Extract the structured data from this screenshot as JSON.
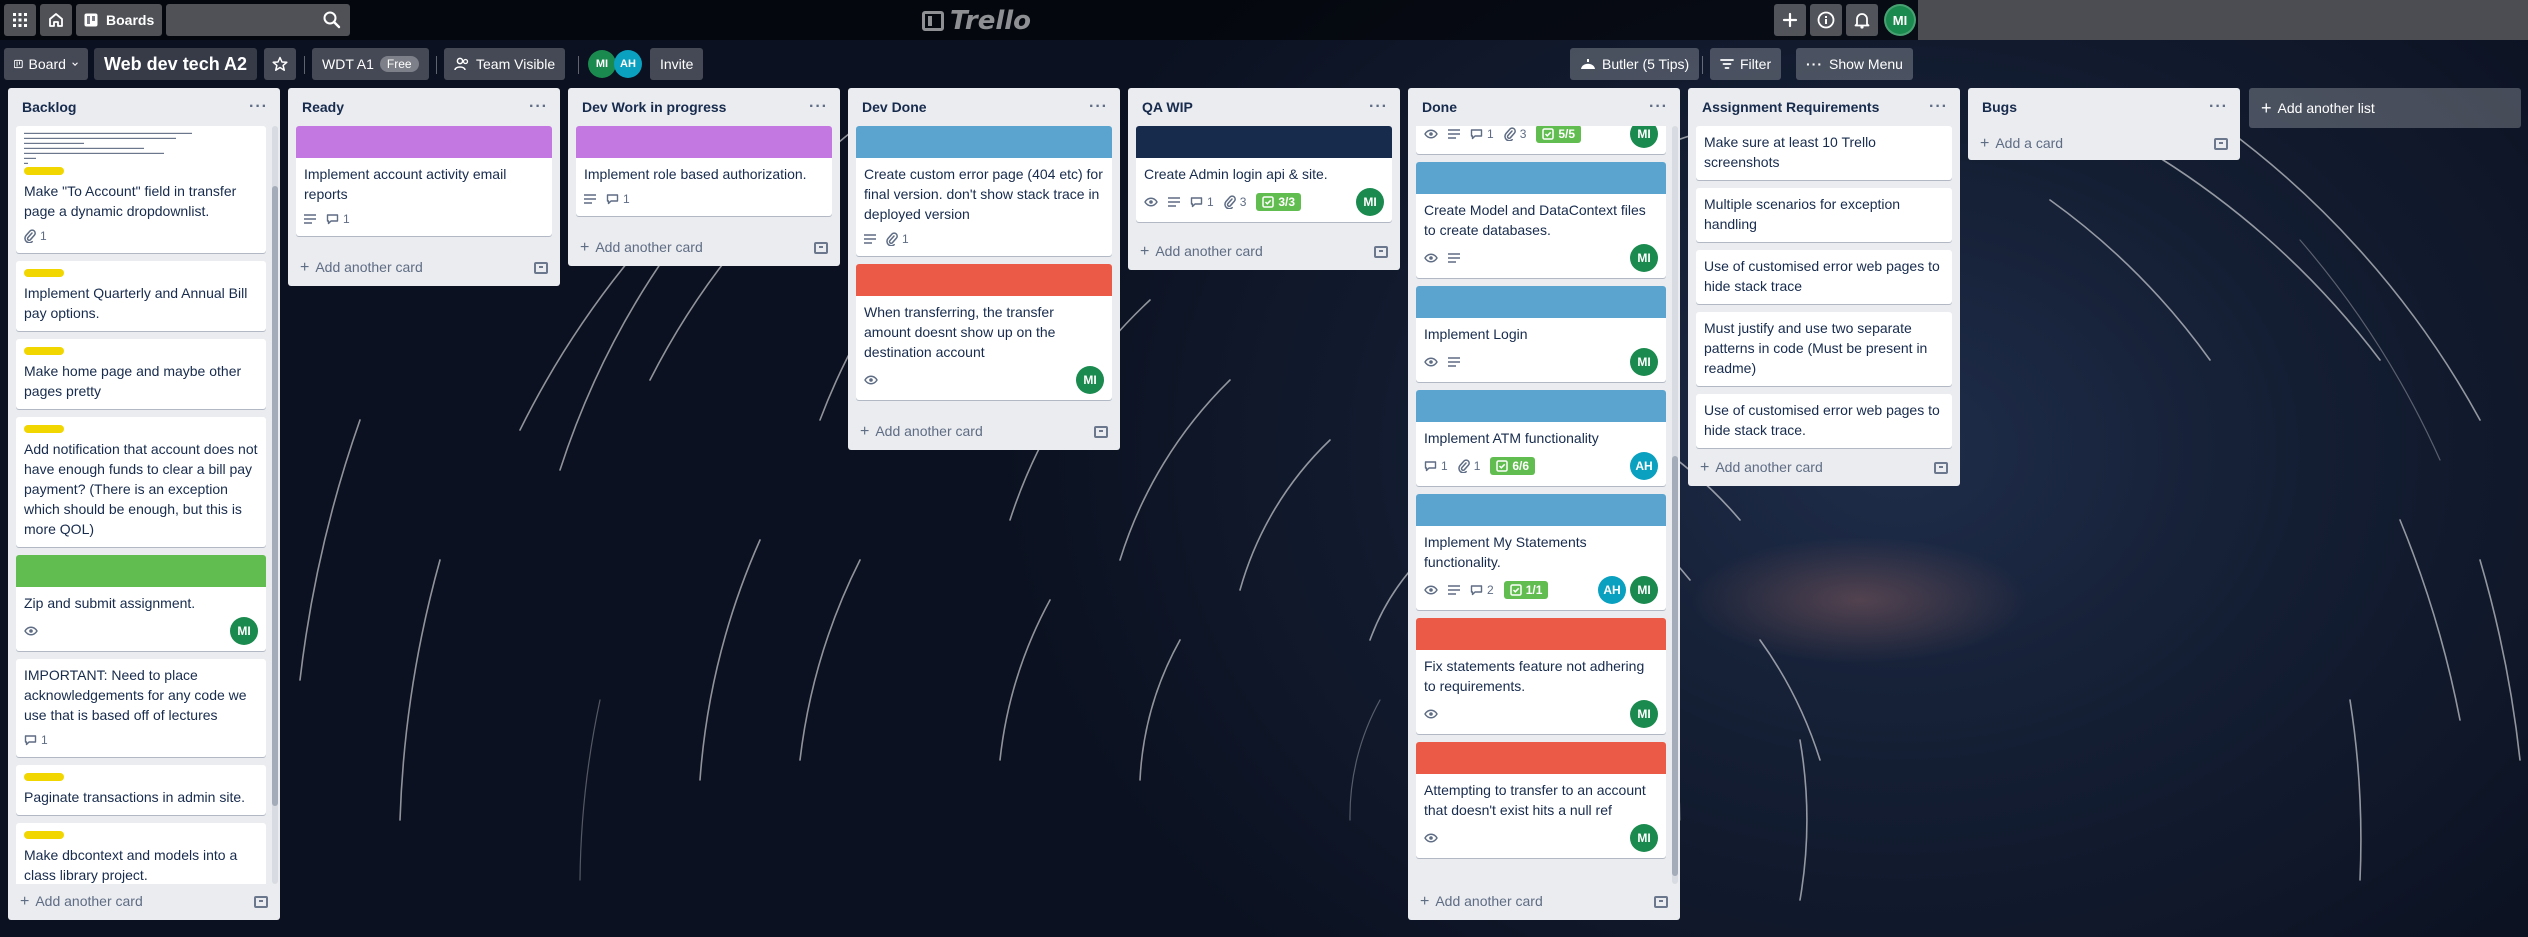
{
  "topbar": {
    "boards_label": "Boards",
    "logo_text": "Trello",
    "current_user": "MI"
  },
  "board": {
    "view_label": "Board",
    "title": "Web dev tech A2",
    "workspace_label": "WDT A1",
    "workspace_badge": "Free",
    "visibility_label": "Team Visible",
    "members": [
      "MI",
      "AH"
    ],
    "invite_label": "Invite",
    "butler_label": "Butler (5 Tips)",
    "filter_label": "Filter",
    "show_menu_label": "Show Menu"
  },
  "colors": {
    "label_yellow": "#f2d600",
    "cover_green": "#61bd4f",
    "cover_purple": "#c377e0",
    "cover_blue": "#5ba4cf",
    "cover_navy": "#172b4d",
    "cover_red": "#eb5a46",
    "avatar_mi": "#1b8a4f",
    "avatar_ah": "#0aa0c0"
  },
  "add_card_label": "Add another card",
  "add_list_label": "Add another list",
  "lists": {
    "backlog": {
      "name": "Backlog",
      "cards": [
        {
          "title": "Make \"To Account\" field in transfer page a dynamic dropdownlist.",
          "attachments": "1"
        },
        {
          "title": "Implement Quarterly and Annual Bill pay options."
        },
        {
          "title": "Make home page and maybe other pages pretty"
        },
        {
          "title": "Add notification that account does not have enough funds to clear a bill pay payment? (There is an exception which should be enough, but this is more QOL)"
        },
        {
          "title": "Zip and submit assignment.",
          "member": "MI"
        },
        {
          "title": "IMPORTANT: Need to place acknowledgements for any code we use that is based off of lectures",
          "comments": "1"
        },
        {
          "title": "Paginate transactions in admin site."
        },
        {
          "title": "Make dbcontext and models into a class library project."
        }
      ]
    },
    "ready": {
      "name": "Ready",
      "cards": [
        {
          "title": "Implement account activity email reports",
          "comments": "1"
        }
      ]
    },
    "devwip": {
      "name": "Dev Work in progress",
      "cards": [
        {
          "title": "Implement role based authorization.",
          "comments": "1"
        }
      ]
    },
    "devdone": {
      "name": "Dev Done",
      "cards": [
        {
          "title": "Create custom error page (404 etc) for final version. don't show stack trace in deployed version",
          "attachments": "1"
        },
        {
          "title": "When transferring, the transfer amount doesnt show up on the destination account",
          "member": "MI"
        }
      ]
    },
    "qawip": {
      "name": "QA WIP",
      "cards": [
        {
          "title": "Create Admin login api & site.",
          "comments": "1",
          "attachments": "3",
          "checklist": "3/3",
          "member": "MI"
        }
      ]
    },
    "done": {
      "name": "Done",
      "cards": [
        {
          "comments": "1",
          "attachments": "3",
          "checklist": "5/5",
          "member": "MI"
        },
        {
          "title": "Create Model and DataContext files to create databases.",
          "member": "MI"
        },
        {
          "title": "Implement Login",
          "member": "MI"
        },
        {
          "title": "Implement ATM functionality",
          "comments": "1",
          "attachments": "1",
          "checklist": "6/6",
          "member": "AH"
        },
        {
          "title": "Implement My Statements functionality.",
          "comments": "2",
          "checklist": "1/1",
          "members": [
            "AH",
            "MI"
          ]
        },
        {
          "title": "Fix statements feature not adhering to requirements.",
          "member": "MI"
        },
        {
          "title": "Attempting to transfer to an account that doesn't exist hits a null ref",
          "member": "MI"
        }
      ]
    },
    "requirements": {
      "name": "Assignment Requirements",
      "cards": [
        {
          "title": "Make sure at least 10 Trello screenshots"
        },
        {
          "title": "Multiple scenarios for exception handling"
        },
        {
          "title": "Use of customised error web pages to hide stack trace"
        },
        {
          "title": "Must justify and use two separate patterns in code (Must be present in readme)"
        },
        {
          "title": "Use of customised error web pages to hide stack trace."
        }
      ]
    },
    "bugs": {
      "name": "Bugs",
      "add_label": "Add a card"
    }
  }
}
